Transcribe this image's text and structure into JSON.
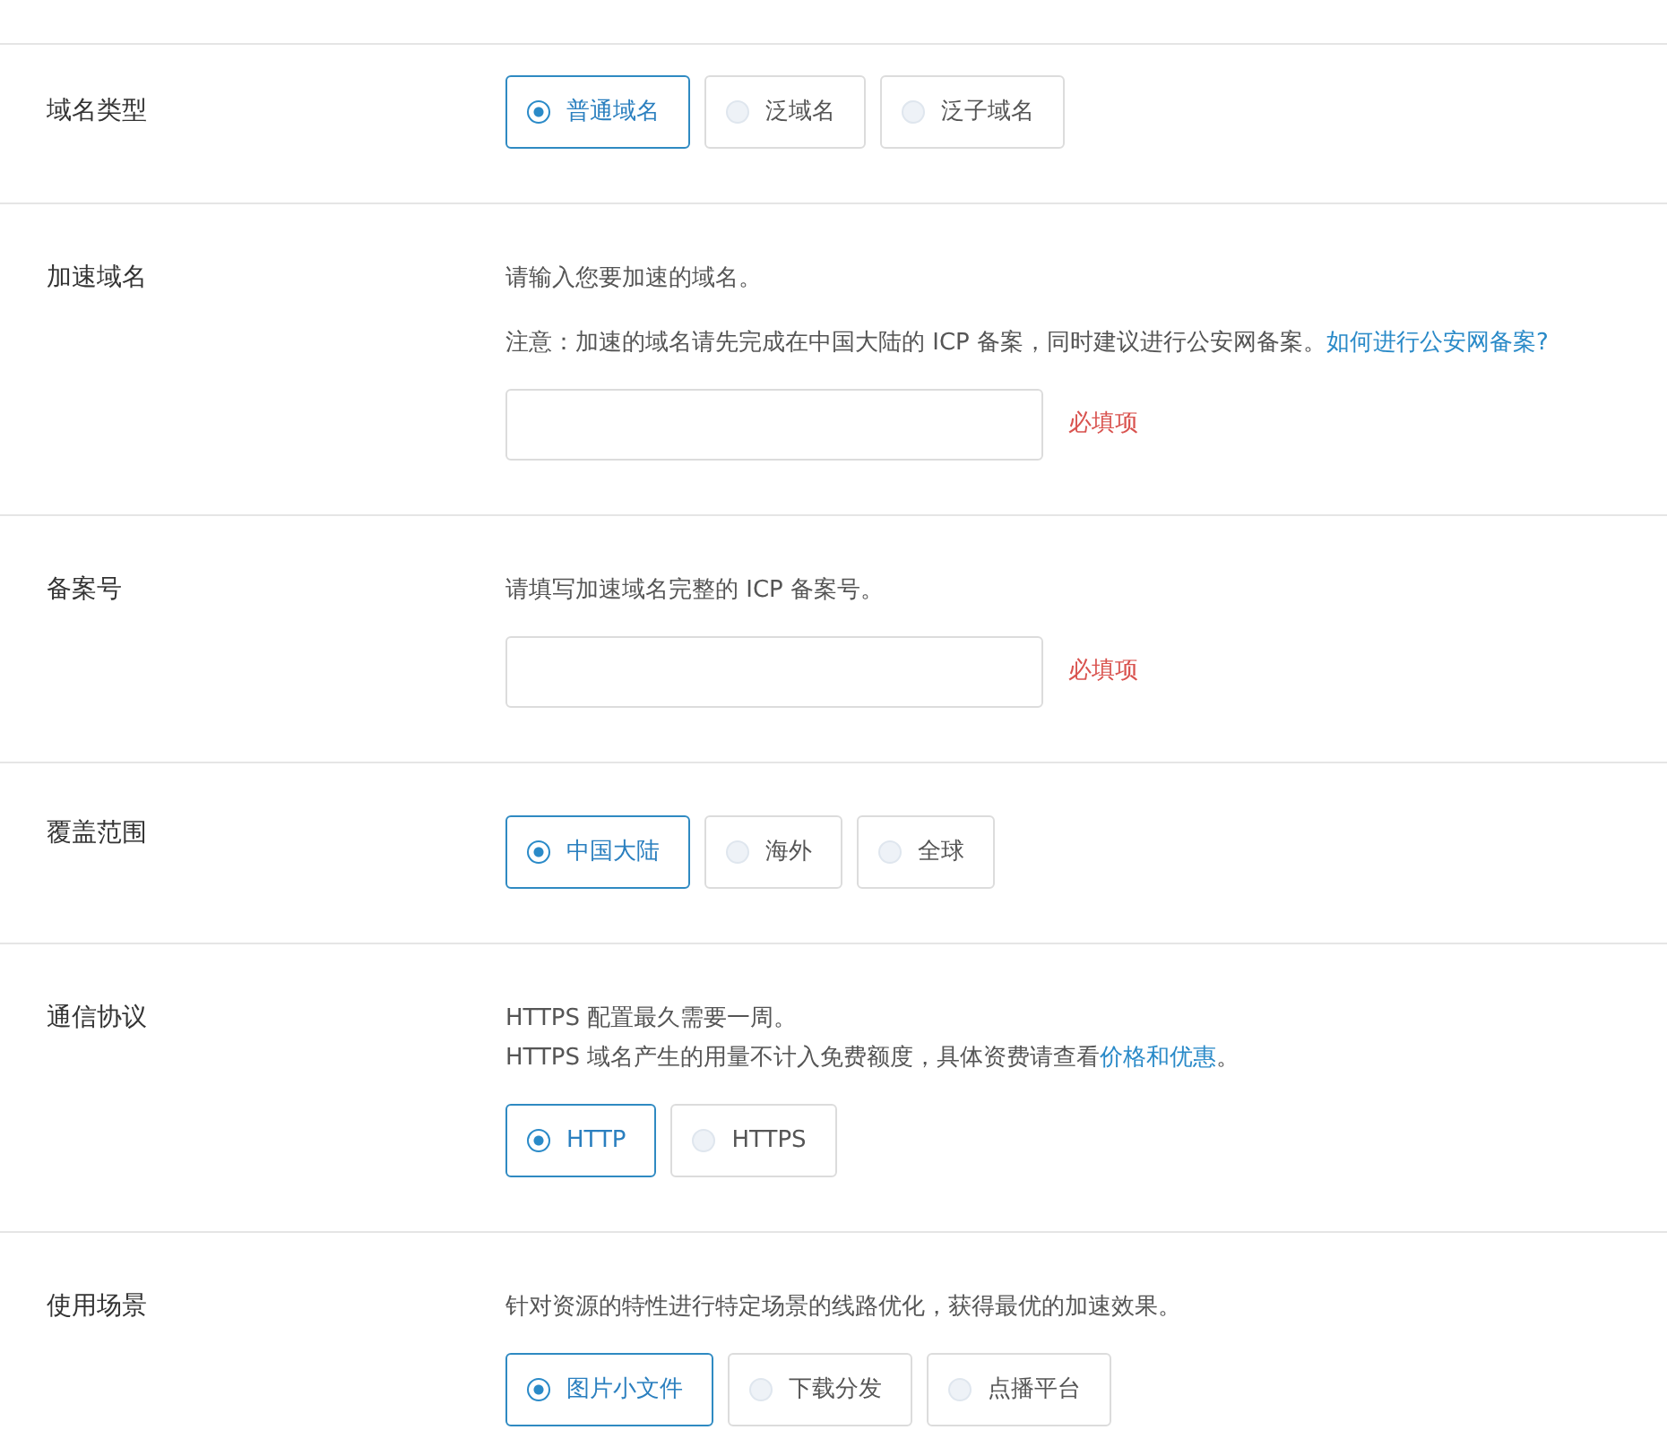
{
  "sections": [
    {
      "label": "域名类型",
      "options": [
        {
          "label": "普通域名",
          "selected": true
        },
        {
          "label": "泛域名",
          "selected": false
        },
        {
          "label": "泛子域名",
          "selected": false
        }
      ]
    },
    {
      "label": "加速域名",
      "paragraphs": [
        {
          "lines": [
            [
              {
                "text": "请输入您要加速的域名。"
              }
            ]
          ]
        },
        {
          "lines": [
            [
              {
                "text": "注意：加速的域名请先完成在中国大陆的 ICP 备案，同时建议进行公安网备案。"
              },
              {
                "link": "如何进行公安网备案?"
              }
            ]
          ]
        }
      ],
      "input": {
        "required": "必填项"
      }
    },
    {
      "label": "备案号",
      "paragraphs": [
        {
          "lines": [
            [
              {
                "text": "请填写加速域名完整的 ICP 备案号。"
              }
            ]
          ]
        }
      ],
      "input": {
        "required": "必填项"
      }
    },
    {
      "label": "覆盖范围",
      "options": [
        {
          "label": "中国大陆",
          "selected": true
        },
        {
          "label": "海外",
          "selected": false
        },
        {
          "label": "全球",
          "selected": false
        }
      ]
    },
    {
      "label": "通信协议",
      "paragraphs": [
        {
          "lines": [
            [
              {
                "text": "HTTPS 配置最久需要一周。"
              }
            ],
            [
              {
                "text": "HTTPS 域名产生的用量不计入免费额度，具体资费请查看"
              },
              {
                "link": "价格和优惠"
              },
              {
                "text": "。"
              }
            ]
          ]
        }
      ],
      "options": [
        {
          "label": "HTTP",
          "selected": true
        },
        {
          "label": "HTTPS",
          "selected": false
        }
      ]
    },
    {
      "label": "使用场景",
      "paragraphs": [
        {
          "lines": [
            [
              {
                "text": "针对资源的特性进行特定场景的线路优化，获得最优的加速效果。"
              }
            ]
          ]
        }
      ],
      "options": [
        {
          "label": "图片小文件",
          "selected": true
        },
        {
          "label": "下载分发",
          "selected": false
        },
        {
          "label": "点播平台",
          "selected": false
        }
      ]
    }
  ]
}
